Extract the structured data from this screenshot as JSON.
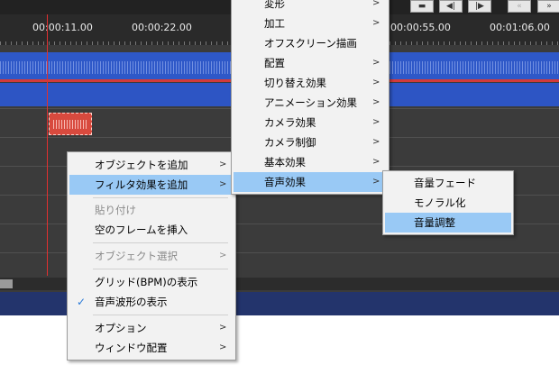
{
  "timeline": {
    "ruler_labels": [
      "00:00:11.00",
      "00:00:22.00",
      "00:00:55.00",
      "00:01:06.00"
    ],
    "top_buttons": [
      "▬",
      "◀|",
      "|▶",
      "«",
      "»"
    ]
  },
  "context_menu": {
    "items": [
      {
        "label": "オブジェクトを追加",
        "submenu": true
      },
      {
        "label": "フィルタ効果を追加",
        "submenu": true,
        "selected": true
      },
      {
        "label": "貼り付け",
        "disabled": true
      },
      {
        "label": "空のフレームを挿入"
      },
      {
        "label": "オブジェクト選択",
        "submenu": true,
        "disabled": true
      },
      {
        "label": "グリッド(BPM)の表示"
      },
      {
        "label": "音声波形の表示",
        "checked": true
      },
      {
        "label": "オプション",
        "submenu": true
      },
      {
        "label": "ウィンドウ配置",
        "submenu": true
      }
    ],
    "check_glyph": "✓"
  },
  "filter_menu": {
    "items": [
      {
        "label": "変形",
        "submenu": true
      },
      {
        "label": "加工",
        "submenu": true
      },
      {
        "label": "オフスクリーン描画"
      },
      {
        "label": "配置",
        "submenu": true
      },
      {
        "label": "切り替え効果",
        "submenu": true
      },
      {
        "label": "アニメーション効果",
        "submenu": true
      },
      {
        "label": "カメラ効果",
        "submenu": true
      },
      {
        "label": "カメラ制御",
        "submenu": true
      },
      {
        "label": "基本効果",
        "submenu": true
      },
      {
        "label": "音声効果",
        "submenu": true,
        "selected": true
      }
    ]
  },
  "audio_menu": {
    "items": [
      {
        "label": "音量フェード"
      },
      {
        "label": "モノラル化"
      },
      {
        "label": "音量調整",
        "selected": true
      }
    ]
  },
  "submenu_arrow": ">",
  "colors": {
    "menu_highlight": "#99c9f5",
    "audio_track": "#2e58c8",
    "clip": "#d84a3e",
    "playhead": "#e03030"
  }
}
